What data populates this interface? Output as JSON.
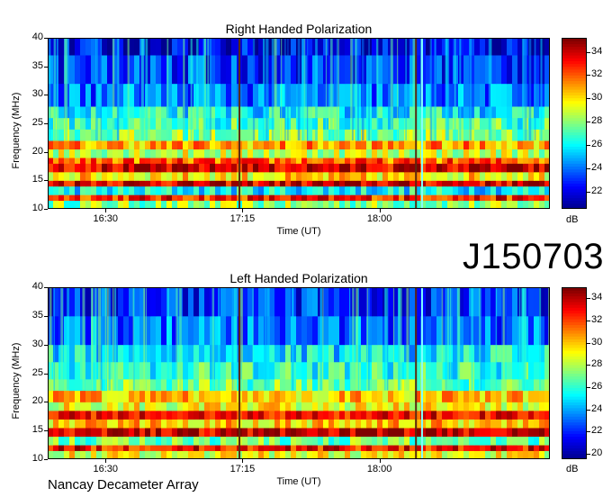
{
  "chart_data": [
    {
      "type": "heatmap",
      "title": "Right Handed Polarization",
      "xlabel": "Time (UT)",
      "ylabel": "Frequency (MHz)",
      "xticks": [
        "16:30",
        "17:15",
        "18:00"
      ],
      "yticks": [
        "10",
        "15",
        "20",
        "25",
        "30",
        "35",
        "40"
      ],
      "ylim": [
        10,
        40
      ],
      "xlim": [
        "16:11",
        "18:56"
      ],
      "colorbar": {
        "label": "dB",
        "ticks": [
          "22",
          "24",
          "26",
          "28",
          "30",
          "32",
          "34"
        ],
        "range": [
          20.5,
          35.2
        ]
      },
      "colormap": [
        "#00008f",
        "#0000ff",
        "#0080ff",
        "#00ffff",
        "#80ff80",
        "#ffff00",
        "#ff8000",
        "#ff0000",
        "#800000"
      ],
      "bands": [
        {
          "f0": 10,
          "f1": 11.5,
          "db": 28
        },
        {
          "f0": 11.5,
          "f1": 12.5,
          "db": 33
        },
        {
          "f0": 12.5,
          "f1": 14,
          "db": 26
        },
        {
          "f0": 14,
          "f1": 15,
          "db": 34
        },
        {
          "f0": 15,
          "f1": 16.5,
          "db": 30
        },
        {
          "f0": 16.5,
          "f1": 18,
          "db": 34
        },
        {
          "f0": 18,
          "f1": 19,
          "db": 32
        },
        {
          "f0": 19,
          "f1": 20.5,
          "db": 29
        },
        {
          "f0": 20.5,
          "f1": 22,
          "db": 31
        },
        {
          "f0": 22,
          "f1": 24,
          "db": 28
        },
        {
          "f0": 24,
          "f1": 26,
          "db": 27
        },
        {
          "f0": 26,
          "f1": 28,
          "db": 26
        },
        {
          "f0": 28,
          "f1": 32,
          "db": 24
        },
        {
          "f0": 32,
          "f1": 37,
          "db": 23
        },
        {
          "f0": 37,
          "f1": 40,
          "db": 22
        }
      ],
      "features": [
        {
          "time": "17:14",
          "kind": "dark-vertical-line"
        },
        {
          "time": "18:12",
          "kind": "dark-vertical-line"
        },
        {
          "time": "18:14",
          "kind": "cyan-vertical-line"
        }
      ]
    },
    {
      "type": "heatmap",
      "title": "Left Handed Polarization",
      "xlabel": "Time (UT)",
      "ylabel": "Frequency (MHz)",
      "xticks": [
        "16:30",
        "17:15",
        "18:00"
      ],
      "yticks": [
        "10",
        "15",
        "20",
        "25",
        "30",
        "35",
        "40"
      ],
      "ylim": [
        10,
        40
      ],
      "xlim": [
        "16:11",
        "18:56"
      ],
      "colorbar": {
        "label": "dB",
        "ticks": [
          "20",
          "22",
          "24",
          "26",
          "28",
          "30",
          "32",
          "34"
        ],
        "range": [
          19.5,
          35.0
        ]
      },
      "colormap": [
        "#00008f",
        "#0000ff",
        "#0080ff",
        "#00ffff",
        "#80ff80",
        "#ffff00",
        "#ff8000",
        "#ff0000",
        "#800000"
      ],
      "bands": [
        {
          "f0": 10,
          "f1": 11.5,
          "db": 29
        },
        {
          "f0": 11.5,
          "f1": 12.5,
          "db": 33
        },
        {
          "f0": 12.5,
          "f1": 14,
          "db": 27
        },
        {
          "f0": 14,
          "f1": 15.5,
          "db": 34
        },
        {
          "f0": 15.5,
          "f1": 17,
          "db": 30
        },
        {
          "f0": 17,
          "f1": 18.5,
          "db": 33
        },
        {
          "f0": 18.5,
          "f1": 20,
          "db": 29
        },
        {
          "f0": 20,
          "f1": 22,
          "db": 30
        },
        {
          "f0": 22,
          "f1": 24,
          "db": 27
        },
        {
          "f0": 24,
          "f1": 27,
          "db": 26
        },
        {
          "f0": 27,
          "f1": 30,
          "db": 25
        },
        {
          "f0": 30,
          "f1": 35,
          "db": 23
        },
        {
          "f0": 35,
          "f1": 40,
          "db": 22
        }
      ],
      "features": [
        {
          "time": "17:14",
          "kind": "dark-vertical-line"
        },
        {
          "time": "18:12",
          "kind": "dark-vertical-line"
        },
        {
          "time": "18:14",
          "kind": "cyan-vertical-line"
        }
      ]
    }
  ],
  "observation_id": "J150703",
  "footer": "Nancay Decameter Array"
}
